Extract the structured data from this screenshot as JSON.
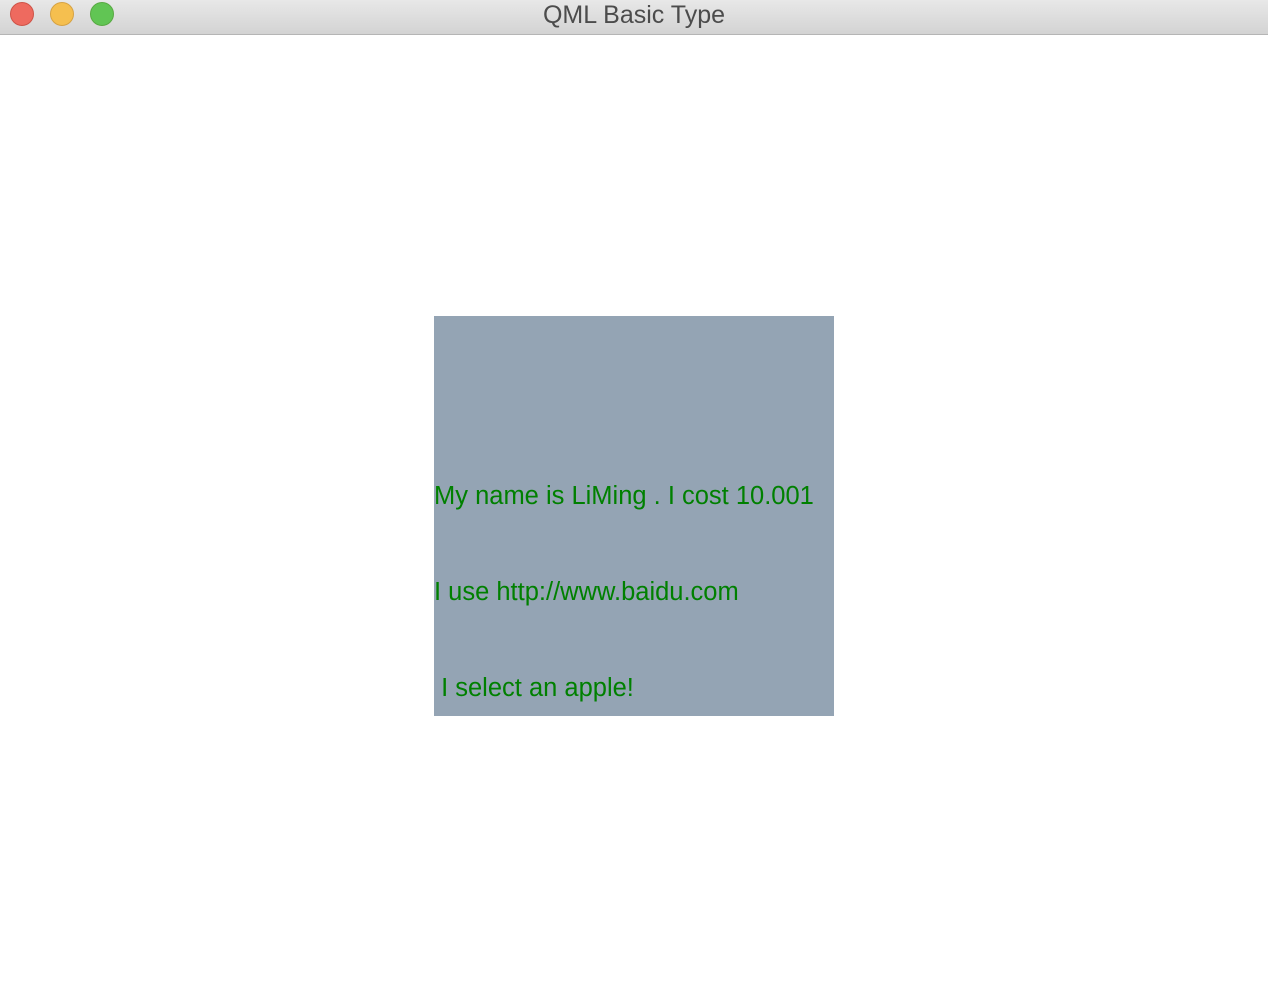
{
  "window": {
    "title": "QML Basic Type"
  },
  "panel": {
    "background_color": "#94a4b4",
    "text_color": "#008000",
    "lines": [
      "My name is LiMing . I cost 10.001",
      "I use http://www.baidu.com",
      " I select an apple!"
    ]
  }
}
